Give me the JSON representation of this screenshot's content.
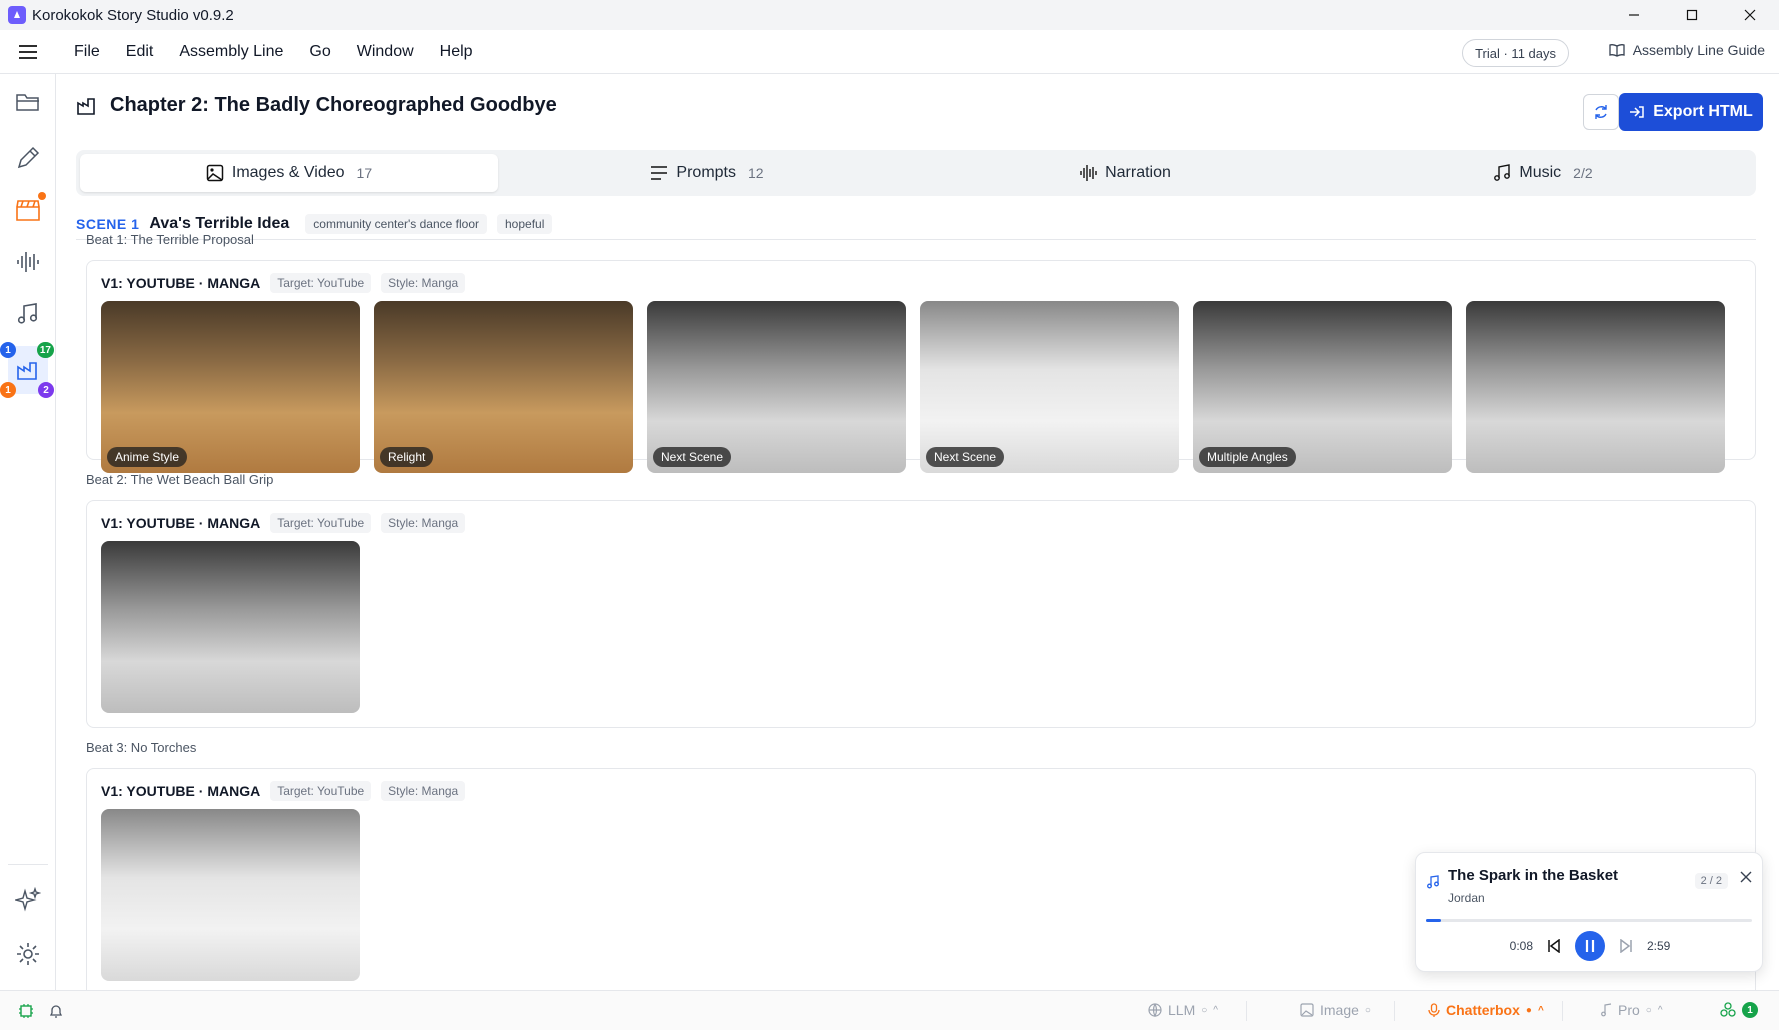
{
  "window": {
    "title": "Korokokok Story Studio v0.9.2"
  },
  "menu": {
    "items": [
      "File",
      "Edit",
      "Assembly Line",
      "Go",
      "Window",
      "Help"
    ],
    "trial": "Trial · 11 days",
    "guide": "Assembly Line Guide"
  },
  "sidebar": {
    "badges": {
      "top_left": "1",
      "top_right": "17",
      "bottom_left": "1",
      "bottom_right": "2"
    }
  },
  "header": {
    "chapter_title": "Chapter 2: The Badly Choreographed Goodbye",
    "export_label": "Export HTML"
  },
  "tabs": [
    {
      "label": "Images & Video",
      "count": "17"
    },
    {
      "label": "Prompts",
      "count": "12"
    },
    {
      "label": "Narration",
      "count": ""
    },
    {
      "label": "Music",
      "count": "2/2"
    }
  ],
  "scene": {
    "number": "SCENE 1",
    "title": "Ava's Terrible Idea",
    "location": "community center's dance floor",
    "mood": "hopeful"
  },
  "beats": [
    {
      "label": "Beat 1: The Terrible Proposal",
      "variant": "V1: YOUTUBE · MANGA",
      "target": "Target: YouTube",
      "style": "Style: Manga",
      "thumbs": [
        "Anime Style",
        "Relight",
        "Next Scene",
        "Next Scene",
        "Multiple Angles",
        ""
      ]
    },
    {
      "label": "Beat 2: The Wet Beach Ball Grip",
      "variant": "V1: YOUTUBE · MANGA",
      "target": "Target: YouTube",
      "style": "Style: Manga"
    },
    {
      "label": "Beat 3: No Torches",
      "variant": "V1: YOUTUBE · MANGA",
      "target": "Target: YouTube",
      "style": "Style: Manga"
    }
  ],
  "player": {
    "song": "The Spark in the Basket",
    "artist": "Jordan",
    "position": "2 / 2",
    "elapsed": "0:08",
    "duration": "2:59",
    "progress": 0.045
  },
  "status": {
    "llm": "LLM",
    "image": "Image",
    "chatterbox": "Chatterbox",
    "pro": "Pro",
    "indicator": "1"
  },
  "colors": {
    "accent": "#1d4ed8",
    "scene_label": "#2563eb",
    "warning": "#f97316",
    "success": "#16a34a",
    "purple": "#7c3aed"
  }
}
